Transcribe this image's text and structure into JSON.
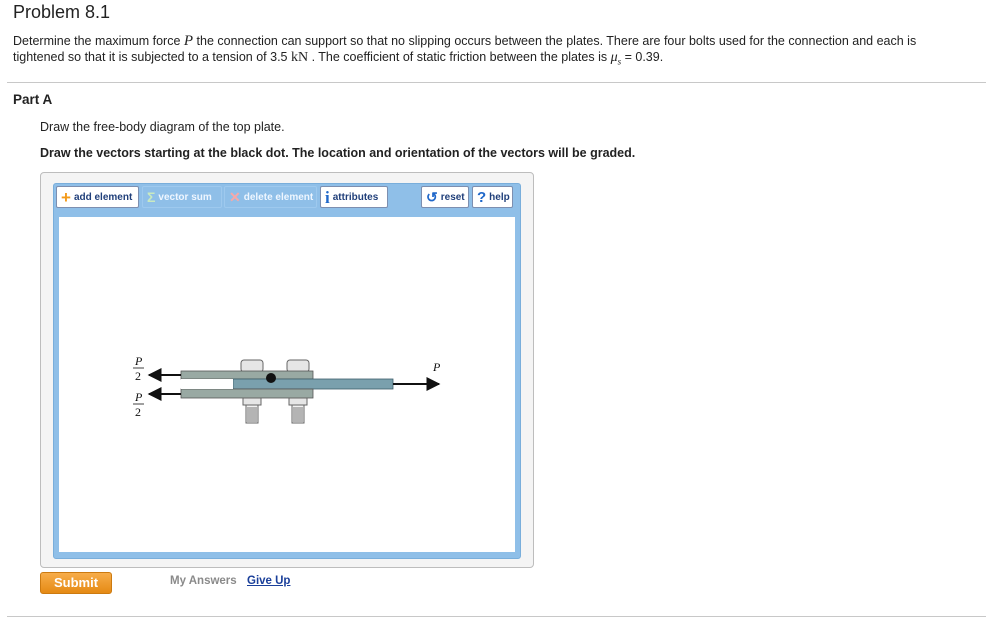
{
  "problem": {
    "title": "Problem 8.1",
    "statement": {
      "t1": "Determine the maximum force ",
      "sym_p": "P",
      "t2": " the connection can support so that no slipping occurs between the plates. There are four bolts used for the connection and each is",
      "t3": "tightened so that it is subjected to a tension of 3.5 ",
      "unit": "kN",
      "t4": " . The coefficient of static friction between the plates is ",
      "mu": "μ",
      "mu_sub": "s",
      "t5": " = 0.39."
    }
  },
  "part": {
    "label": "Part A",
    "instruction": "Draw the free-body diagram of the top plate.",
    "instruction_bold": "Draw the vectors starting at the black dot. The location and orientation of the vectors will be graded."
  },
  "toolbar": {
    "add_element": "add element",
    "vector_sum": "vector sum",
    "delete_element": "delete element",
    "attributes": "attributes",
    "reset": "reset",
    "help": "help"
  },
  "icons": {
    "add": "plus-icon",
    "vector_sum": "sigma-icon",
    "delete": "x-icon",
    "attributes": "info-icon",
    "reset": "reset-icon",
    "help": "question-icon"
  },
  "figure": {
    "label_p": "P",
    "label_half_num": "P",
    "label_half_den": "2"
  },
  "actions": {
    "submit": "Submit",
    "my_answers": "My Answers",
    "give_up": "Give Up"
  },
  "colors": {
    "accent": "#f39a19",
    "tool_frame": "#8fbfe8",
    "link": "#1a3f9a",
    "plate_top": "#7aa0ad",
    "plate_bottom": "#99a9a3"
  }
}
